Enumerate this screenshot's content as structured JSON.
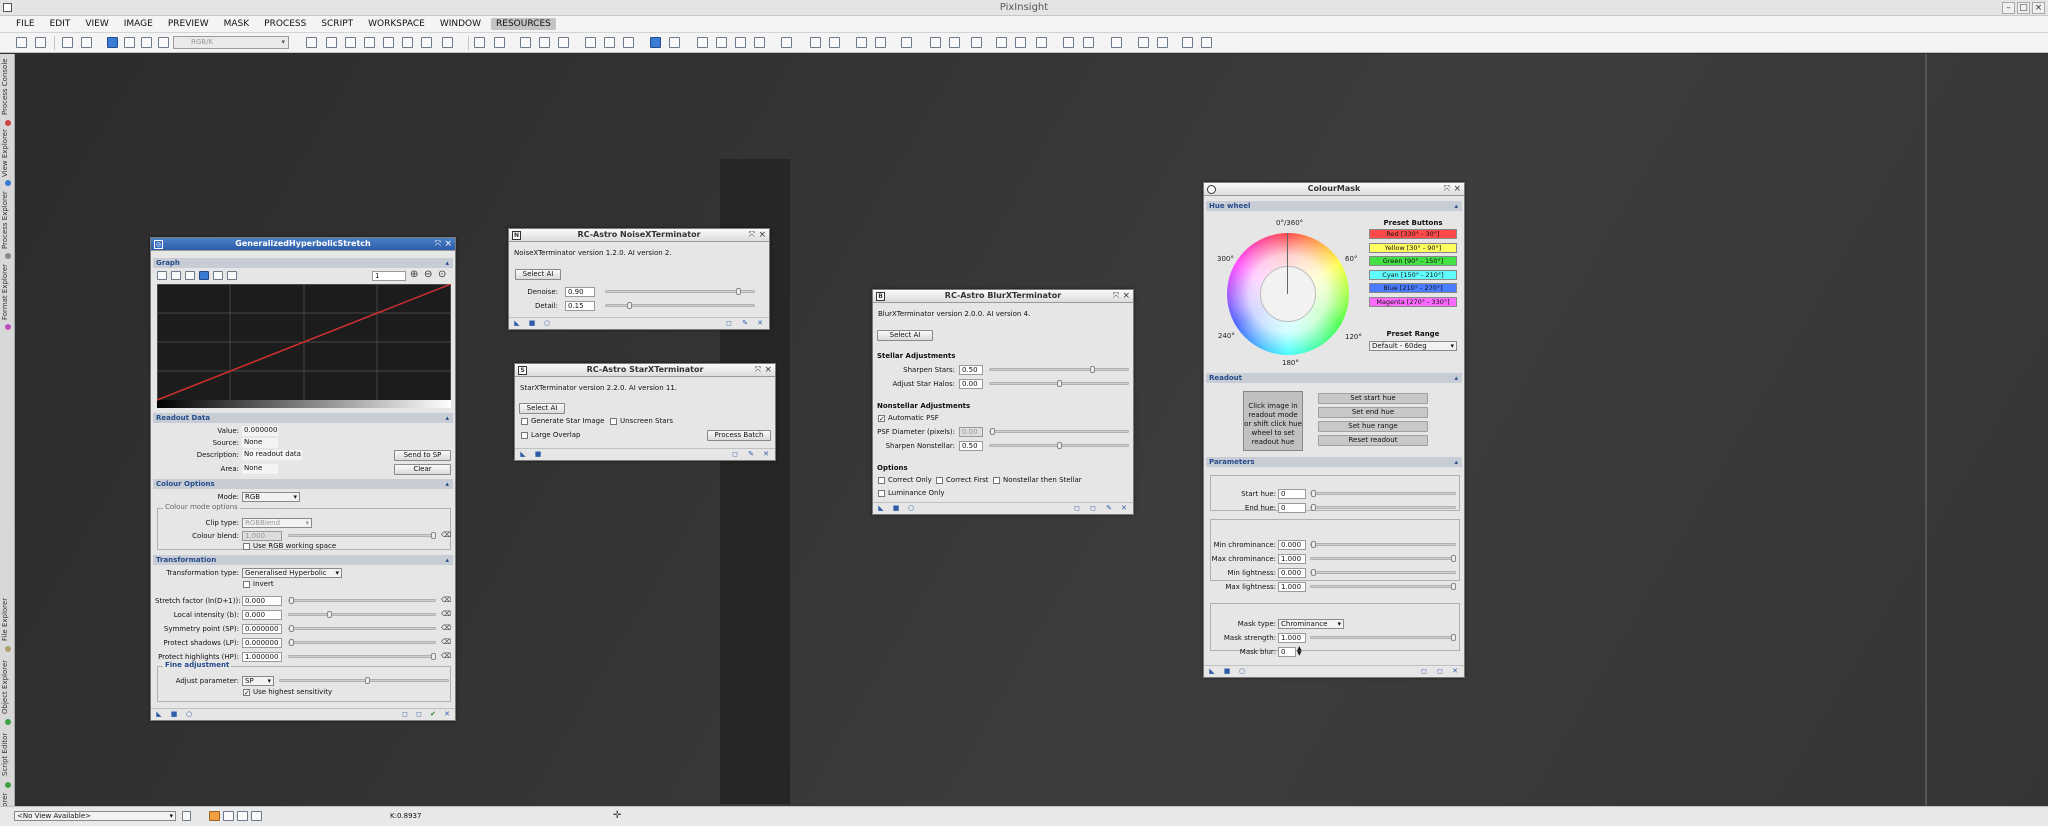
{
  "app": {
    "title": "PixInsight"
  },
  "menu": [
    "FILE",
    "EDIT",
    "VIEW",
    "IMAGE",
    "PREVIEW",
    "MASK",
    "PROCESS",
    "SCRIPT",
    "WORKSPACE",
    "WINDOW",
    "RESOURCES"
  ],
  "toolbar": {
    "rgb_selector": "RGB/K"
  },
  "sidebar": [
    "Process Console",
    "View Explorer",
    "Process Explorer",
    "Format Explorer",
    "File Explorer",
    "Object Explorer",
    "Script Editor",
    "History Explorer"
  ],
  "statusbar": {
    "view_selector": "<No View Available>",
    "readout": "K:0.8937"
  },
  "colors": {
    "accent": "#2d5da8",
    "active_title": "#3a6fbf",
    "curve": "#d03030",
    "desktop": "#2d2d2d"
  },
  "ghs": {
    "title": "GeneralizedHyperbolicStretch",
    "graph_head": "Graph",
    "zoom_value": "1",
    "readout_head": "Readout Data",
    "value_label": "Value:",
    "value": "0.000000",
    "source_label": "Source:",
    "source": "None",
    "desc_label": "Description:",
    "desc": "No readout data",
    "area_label": "Area:",
    "area": "None",
    "send_btn": "Send to SP",
    "clear_btn": "Clear",
    "colour_head": "Colour Options",
    "mode_label": "Mode:",
    "mode": "RGB",
    "colour_mode_group": "Colour mode options",
    "clip_label": "Clip type:",
    "clip": "RGBBlend",
    "blend_label": "Colour blend:",
    "blend": "1.000",
    "rgbws_label": "Use RGB working space",
    "trans_head": "Transformation",
    "ttype_label": "Transformation type:",
    "ttype": "Generalised Hyperbolic",
    "invert_label": "Invert",
    "params": [
      {
        "label": "Stretch factor (ln(D+1)):",
        "value": "0.000",
        "pos": 0.0
      },
      {
        "label": "Local intensity (b):",
        "value": "0.000",
        "pos": 0.27
      },
      {
        "label": "Symmetry point (SP):",
        "value": "0.000000",
        "pos": 0.0
      },
      {
        "label": "Protect shadows (LP):",
        "value": "0.000000",
        "pos": 0.0
      },
      {
        "label": "Protect highlights (HP):",
        "value": "1.000000",
        "pos": 1.0
      }
    ],
    "fine_group": "Fine adjustment",
    "adjust_label": "Adjust parameter:",
    "adjust": "SP",
    "highsens_label": "Use highest sensitivity"
  },
  "nxt": {
    "title": "RC-Astro NoiseXTerminator",
    "version": "NoiseXTerminator version 1.2.0. AI version 2.",
    "select_ai": "Select AI",
    "denoise_label": "Denoise:",
    "denoise": "0.90",
    "detail_label": "Detail:",
    "detail": "0.15"
  },
  "sxt": {
    "title": "RC-Astro StarXTerminator",
    "version": "StarXTerminator version 2.2.0. AI version 11.",
    "select_ai": "Select AI",
    "gen_star": "Generate Star Image",
    "unscreen": "Unscreen Stars",
    "large_overlap": "Large Overlap",
    "process_batch": "Process Batch"
  },
  "bxt": {
    "title": "RC-Astro BlurXTerminator",
    "version": "BlurXTerminator version 2.0.0. AI version 4.",
    "select_ai": "Select AI",
    "stellar_head": "Stellar Adjustments",
    "sharpen_stars_label": "Sharpen Stars:",
    "sharpen_stars": "0.50",
    "halos_label": "Adjust Star Halos:",
    "halos": "0.00",
    "nonstellar_head": "Nonstellar Adjustments",
    "auto_psf": "Automatic PSF",
    "psf_label": "PSF Diameter (pixels):",
    "psf": "0.00",
    "sharpen_ns_label": "Sharpen Nonstellar:",
    "sharpen_ns": "0.50",
    "options_head": "Options",
    "correct_only": "Correct Only",
    "correct_first": "Correct First",
    "ns_then_stellar": "Nonstellar then Stellar",
    "lum_only": "Luminance Only"
  },
  "cm": {
    "title": "ColourMask",
    "hue_head": "Hue wheel",
    "angles": {
      "top": "0°/360°",
      "tr": "60°",
      "br": "120°",
      "bottom": "180°",
      "bl": "240°",
      "tl": "300°"
    },
    "preset_head": "Preset Buttons",
    "presets": [
      {
        "label": "Red [330° - 30°]",
        "color": "#ff4a4a"
      },
      {
        "label": "Yellow [30° - 90°]",
        "color": "#ffff60"
      },
      {
        "label": "Green [90° - 150°]",
        "color": "#44e044"
      },
      {
        "label": "Cyan [150° - 210°]",
        "color": "#60ffff"
      },
      {
        "label": "Blue [210° - 270°]",
        "color": "#4a7cff"
      },
      {
        "label": "Magenta [270° - 330°]",
        "color": "#ff6aff"
      }
    ],
    "range_head": "Preset Range",
    "range": "Default - 60deg",
    "readout_head": "Readout",
    "readout_info": "Click image in readout mode or shift click hue wheel to set readout hue",
    "set_start": "Set start hue",
    "set_end": "Set end hue",
    "set_range": "Set hue range",
    "reset": "Reset readout",
    "params_head": "Parameters",
    "start_hue_label": "Start hue:",
    "start_hue": "0",
    "end_hue_label": "End hue:",
    "end_hue": "0",
    "min_chroma_label": "Min chrominance:",
    "min_chroma": "0.000",
    "max_chroma_label": "Max chrominance:",
    "max_chroma": "1.000",
    "min_light_label": "Min lightness:",
    "min_light": "0.000",
    "max_light_label": "Max lightness:",
    "max_light": "1.000",
    "mask_type_label": "Mask type:",
    "mask_type": "Chrominance",
    "mask_strength_label": "Mask strength:",
    "mask_strength": "1.000",
    "mask_blur_label": "Mask blur:",
    "mask_blur": "0"
  }
}
